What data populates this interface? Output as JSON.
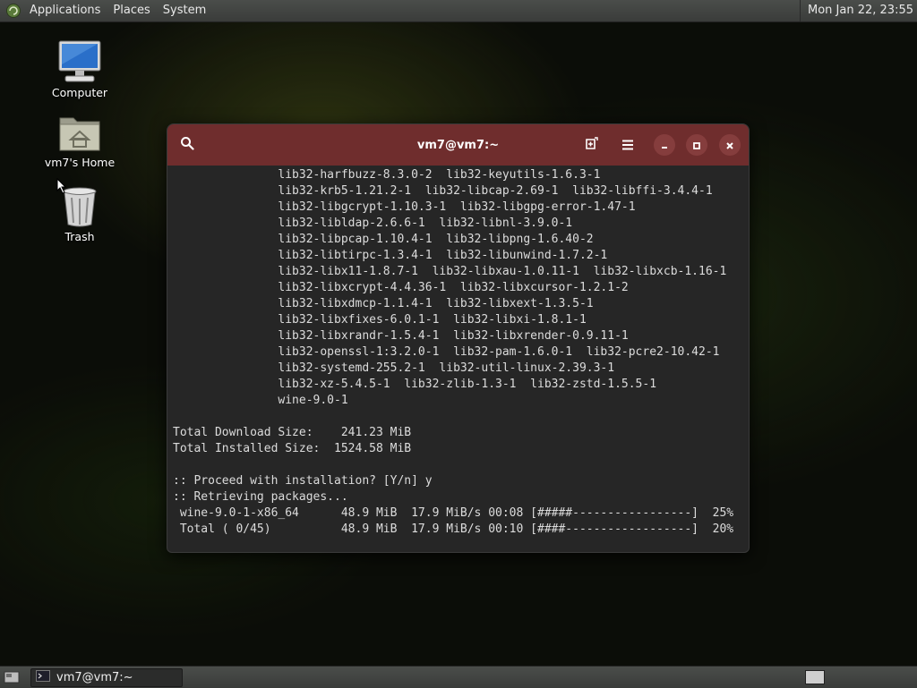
{
  "top_panel": {
    "menus": [
      "Applications",
      "Places",
      "System"
    ],
    "clock": "Mon Jan 22, 23:55"
  },
  "desktop": {
    "icons": [
      {
        "label": "Computer",
        "icon": "computer-icon"
      },
      {
        "label": "vm7's Home",
        "icon": "home-folder-icon"
      },
      {
        "label": "Trash",
        "icon": "trash-icon"
      }
    ]
  },
  "terminal": {
    "title": "vm7@vm7:~",
    "lines": [
      "               lib32-harfbuzz-8.3.0-2  lib32-keyutils-1.6.3-1",
      "               lib32-krb5-1.21.2-1  lib32-libcap-2.69-1  lib32-libffi-3.4.4-1",
      "               lib32-libgcrypt-1.10.3-1  lib32-libgpg-error-1.47-1",
      "               lib32-libldap-2.6.6-1  lib32-libnl-3.9.0-1",
      "               lib32-libpcap-1.10.4-1  lib32-libpng-1.6.40-2",
      "               lib32-libtirpc-1.3.4-1  lib32-libunwind-1.7.2-1",
      "               lib32-libx11-1.8.7-1  lib32-libxau-1.0.11-1  lib32-libxcb-1.16-1",
      "               lib32-libxcrypt-4.4.36-1  lib32-libxcursor-1.2.1-2",
      "               lib32-libxdmcp-1.1.4-1  lib32-libxext-1.3.5-1",
      "               lib32-libxfixes-6.0.1-1  lib32-libxi-1.8.1-1",
      "               lib32-libxrandr-1.5.4-1  lib32-libxrender-0.9.11-1",
      "               lib32-openssl-1:3.2.0-1  lib32-pam-1.6.0-1  lib32-pcre2-10.42-1",
      "               lib32-systemd-255.2-1  lib32-util-linux-2.39.3-1",
      "               lib32-xz-5.4.5-1  lib32-zlib-1.3-1  lib32-zstd-1.5.5-1",
      "               wine-9.0-1",
      "",
      "Total Download Size:    241.23 MiB",
      "Total Installed Size:  1524.58 MiB",
      "",
      ":: Proceed with installation? [Y/n] y",
      ":: Retrieving packages...",
      " wine-9.0-1-x86_64      48.9 MiB  17.9 MiB/s 00:08 [#####-----------------]  25%",
      " Total ( 0/45)          48.9 MiB  17.9 MiB/s 00:10 [####------------------]  20%"
    ]
  },
  "taskbar": {
    "task_label": "vm7@vm7:~"
  }
}
